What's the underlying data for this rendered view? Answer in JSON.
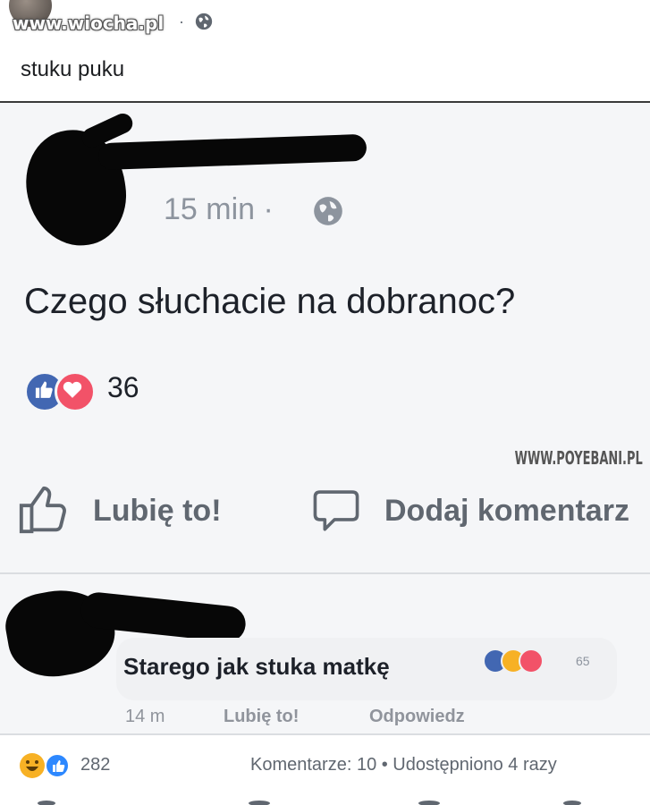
{
  "outer_post": {
    "watermark": "www.wiocha.pl",
    "meta_suffix": ".",
    "caption": "stuku puku"
  },
  "embedded_post": {
    "time": "15 min ·",
    "text": "Czego słuchacie na dobranoc?",
    "reaction_count": "36",
    "watermark": "WWW.POYEBANI.PL",
    "actions": {
      "like_label": "Lubię to!",
      "comment_label": "Dodaj komentarz"
    },
    "comment": {
      "text": "Starego jak stuka matkę",
      "reaction_count": "65",
      "time": "14 m",
      "like_label": "Lubię to!",
      "reply_label": "Odpowiedz"
    }
  },
  "footer": {
    "reaction_count": "282",
    "stats": "Komentarze: 10 • Udostępniono 4 razy"
  },
  "colors": {
    "like_blue": "#4267b2",
    "love_red": "#f25268",
    "haha_yellow": "#f7b125",
    "text_gray": "#606770"
  }
}
